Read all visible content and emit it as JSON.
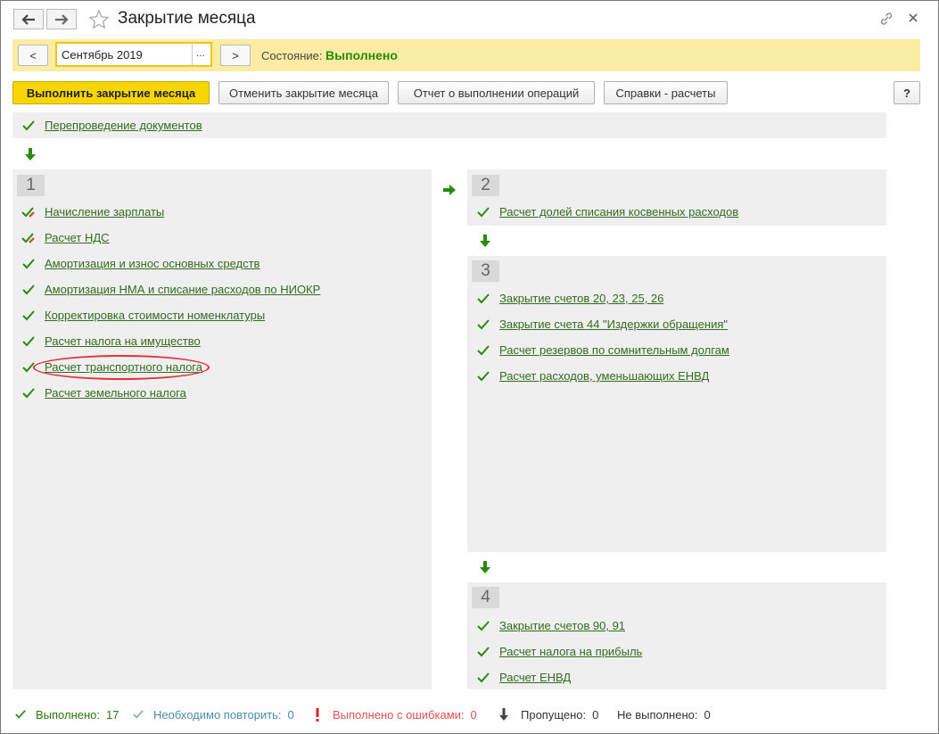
{
  "window": {
    "title": "Закрытие месяца"
  },
  "period": {
    "value": "Сентябрь 2019",
    "prev_label": "<",
    "next_label": ">",
    "more_label": "...",
    "state_label": "Состояние:",
    "state_value": "Выполнено"
  },
  "toolbar": {
    "run_label": "Выполнить закрытие месяца",
    "cancel_label": "Отменить закрытие месяца",
    "report_label": "Отчет о выполнении операций",
    "refs_label": "Справки - расчеты",
    "help_label": "?"
  },
  "top_item": {
    "label": "Перепроведение документов"
  },
  "group1": {
    "number": "1",
    "items": [
      {
        "label": "Начисление зарплаты"
      },
      {
        "label": "Расчет НДС"
      },
      {
        "label": "Амортизация и износ основных средств"
      },
      {
        "label": "Амортизация НМА и списание расходов по НИОКР"
      },
      {
        "label": "Корректировка стоимости номенклатуры"
      },
      {
        "label": "Расчет налога на имущество"
      },
      {
        "label": "Расчет транспортного налога"
      },
      {
        "label": "Расчет земельного налога"
      }
    ]
  },
  "group2": {
    "number": "2",
    "items": [
      {
        "label": "Расчет долей списания косвенных расходов"
      }
    ]
  },
  "group3": {
    "number": "3",
    "items": [
      {
        "label": "Закрытие счетов 20, 23, 25, 26"
      },
      {
        "label": "Закрытие счета 44 \"Издержки обращения\""
      },
      {
        "label": "Расчет резервов по сомнительным долгам"
      },
      {
        "label": "Расчет расходов, уменьшающих ЕНВД"
      }
    ]
  },
  "group4": {
    "number": "4",
    "items": [
      {
        "label": "Закрытие счетов 90, 91"
      },
      {
        "label": "Расчет налога на прибыль"
      },
      {
        "label": "Расчет ЕНВД"
      }
    ]
  },
  "legend": {
    "done_label": "Выполнено:",
    "done_count": "17",
    "repeat_label": "Необходимо повторить:",
    "repeat_count": "0",
    "errors_label": "Выполнено с ошибками:",
    "errors_count": "0",
    "skipped_label": "Пропущено:",
    "skipped_count": "0",
    "notdone_label": "Не выполнено:",
    "notdone_count": "0"
  },
  "colors": {
    "accent_green": "#2a8a0a",
    "status_bar": "#fbeca4",
    "run_button": "#f7d600",
    "link": "#336b1f",
    "highlight": "#e0333b"
  }
}
